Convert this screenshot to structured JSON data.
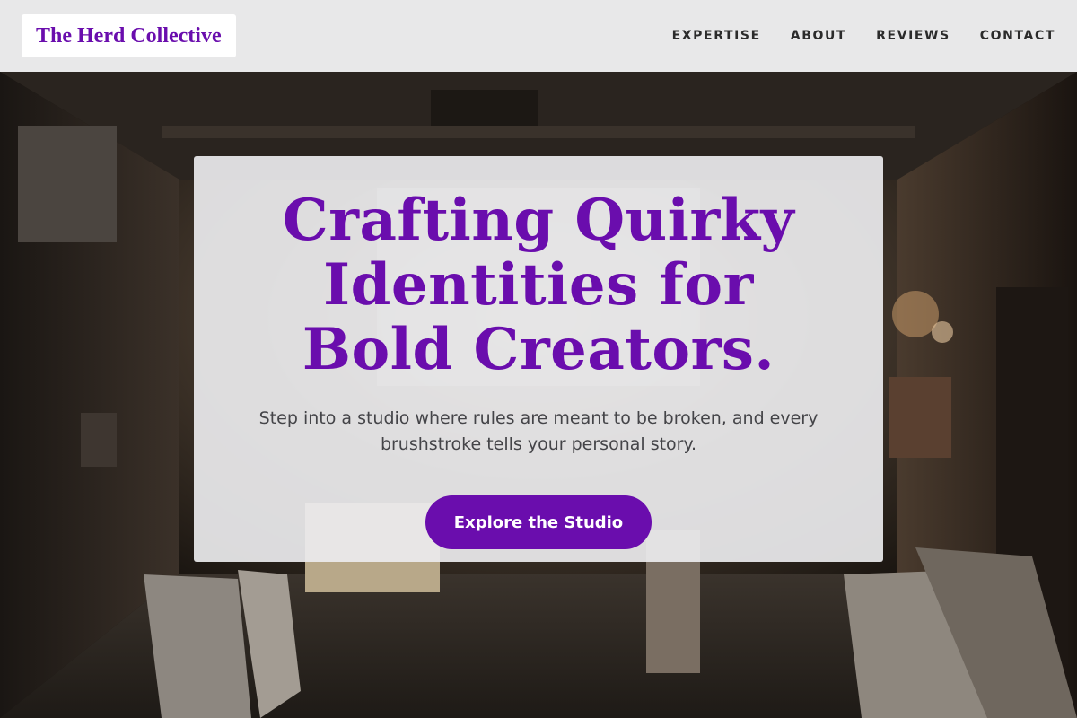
{
  "header": {
    "logo": "The Herd Collective",
    "nav": [
      {
        "label": "EXPERTISE"
      },
      {
        "label": "ABOUT"
      },
      {
        "label": "REVIEWS"
      },
      {
        "label": "CONTACT"
      }
    ]
  },
  "hero": {
    "title": "Crafting Quirky Identities for Bold Creators.",
    "subtitle": "Step into a studio where rules are meant to be broken, and every brushstroke tells your personal story.",
    "cta_label": "Explore the Studio"
  },
  "colors": {
    "brand_purple": "#6a0dad",
    "header_bg": "#e8e8e9",
    "card_bg": "#ececee"
  }
}
